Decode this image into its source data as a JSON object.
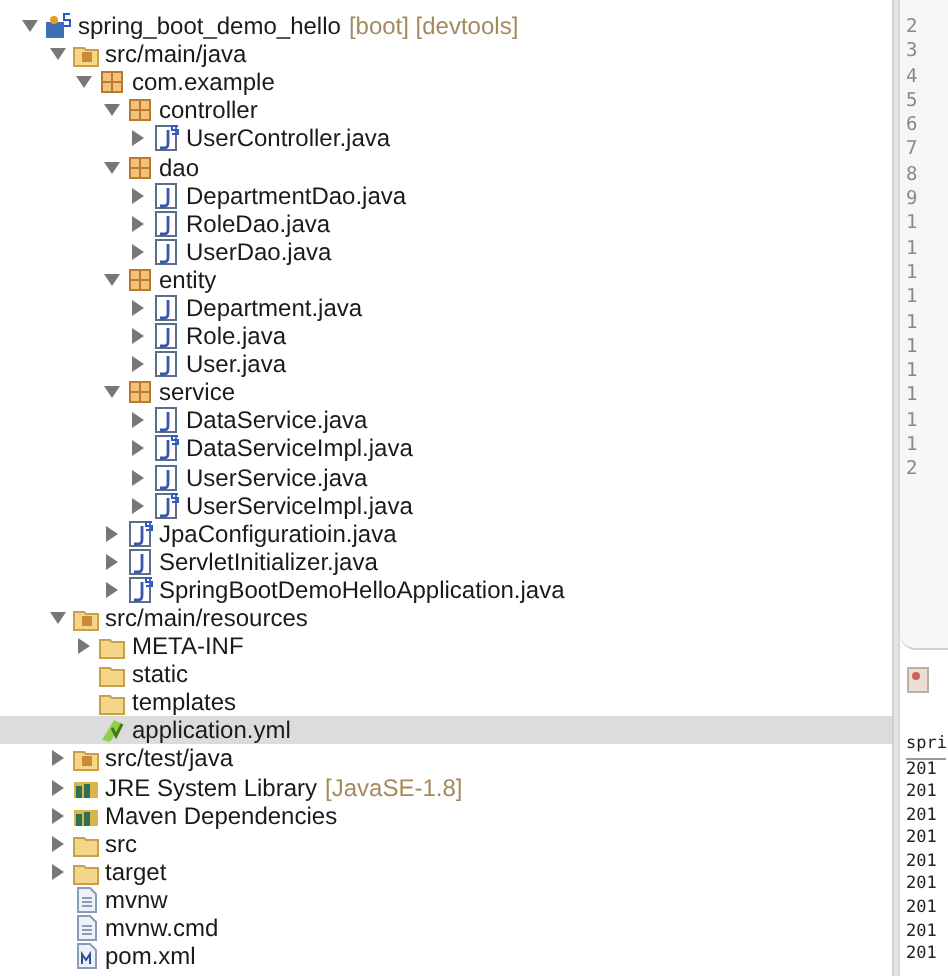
{
  "tree": [
    {
      "label": "spring_boot_demo_hello",
      "decoration": "[boot] [devtools]",
      "kind": "project",
      "expandable": true,
      "expanded": true,
      "selected": false,
      "children": [
        {
          "label": "src/main/java",
          "kind": "source-folder",
          "expandable": true,
          "expanded": true,
          "selected": false,
          "children": [
            {
              "label": "com.example",
              "kind": "package",
              "expandable": true,
              "expanded": true,
              "selected": false,
              "children": [
                {
                  "label": "controller",
                  "kind": "package",
                  "expandable": true,
                  "expanded": true,
                  "selected": false,
                  "children": [
                    {
                      "label": "UserController.java",
                      "kind": "spring-java",
                      "expandable": true,
                      "expanded": false,
                      "selected": false
                    }
                  ]
                },
                {
                  "label": "dao",
                  "kind": "package",
                  "expandable": true,
                  "expanded": true,
                  "selected": false,
                  "children": [
                    {
                      "label": "DepartmentDao.java",
                      "kind": "java",
                      "expandable": true,
                      "expanded": false,
                      "selected": false
                    },
                    {
                      "label": "RoleDao.java",
                      "kind": "java",
                      "expandable": true,
                      "expanded": false,
                      "selected": false
                    },
                    {
                      "label": "UserDao.java",
                      "kind": "java",
                      "expandable": true,
                      "expanded": false,
                      "selected": false
                    }
                  ]
                },
                {
                  "label": "entity",
                  "kind": "package",
                  "expandable": true,
                  "expanded": true,
                  "selected": false,
                  "children": [
                    {
                      "label": "Department.java",
                      "kind": "java",
                      "expandable": true,
                      "expanded": false,
                      "selected": false
                    },
                    {
                      "label": "Role.java",
                      "kind": "java",
                      "expandable": true,
                      "expanded": false,
                      "selected": false
                    },
                    {
                      "label": "User.java",
                      "kind": "java",
                      "expandable": true,
                      "expanded": false,
                      "selected": false
                    }
                  ]
                },
                {
                  "label": "service",
                  "kind": "package",
                  "expandable": true,
                  "expanded": true,
                  "selected": false,
                  "children": [
                    {
                      "label": "DataService.java",
                      "kind": "java",
                      "expandable": true,
                      "expanded": false,
                      "selected": false
                    },
                    {
                      "label": "DataServiceImpl.java",
                      "kind": "spring-java",
                      "expandable": true,
                      "expanded": false,
                      "selected": false
                    },
                    {
                      "label": "UserService.java",
                      "kind": "java",
                      "expandable": true,
                      "expanded": false,
                      "selected": false
                    },
                    {
                      "label": "UserServiceImpl.java",
                      "kind": "spring-java",
                      "expandable": true,
                      "expanded": false,
                      "selected": false
                    }
                  ]
                },
                {
                  "label": "JpaConfiguratioin.java",
                  "kind": "spring-java",
                  "expandable": true,
                  "expanded": false,
                  "selected": false
                },
                {
                  "label": "ServletInitializer.java",
                  "kind": "java",
                  "expandable": true,
                  "expanded": false,
                  "selected": false
                },
                {
                  "label": "SpringBootDemoHelloApplication.java",
                  "kind": "spring-java",
                  "expandable": true,
                  "expanded": false,
                  "selected": false
                }
              ]
            }
          ]
        },
        {
          "label": "src/main/resources",
          "kind": "source-folder",
          "expandable": true,
          "expanded": true,
          "selected": false,
          "children": [
            {
              "label": "META-INF",
              "kind": "folder",
              "expandable": true,
              "expanded": false,
              "selected": false
            },
            {
              "label": "static",
              "kind": "folder",
              "expandable": false,
              "selected": false
            },
            {
              "label": "templates",
              "kind": "folder",
              "expandable": false,
              "selected": false
            },
            {
              "label": "application.yml",
              "kind": "yml",
              "expandable": false,
              "selected": true
            }
          ]
        },
        {
          "label": "src/test/java",
          "kind": "source-folder",
          "expandable": true,
          "expanded": false,
          "selected": false
        },
        {
          "label": "JRE System Library",
          "decoration": "[JavaSE-1.8]",
          "kind": "library",
          "expandable": true,
          "expanded": false,
          "selected": false
        },
        {
          "label": "Maven Dependencies",
          "kind": "library",
          "expandable": true,
          "expanded": false,
          "selected": false
        },
        {
          "label": "src",
          "kind": "folder",
          "expandable": true,
          "expanded": false,
          "selected": false
        },
        {
          "label": "target",
          "kind": "folder",
          "expandable": true,
          "expanded": false,
          "selected": false
        },
        {
          "label": "mvnw",
          "kind": "file",
          "expandable": false,
          "selected": false
        },
        {
          "label": "mvnw.cmd",
          "kind": "file",
          "expandable": false,
          "selected": false
        },
        {
          "label": "pom.xml",
          "kind": "pom",
          "expandable": false,
          "selected": false
        }
      ]
    }
  ],
  "editor": {
    "line_numbers": [
      "2",
      "3",
      "4",
      "5",
      "6",
      "7",
      "8",
      "9",
      "1",
      "1",
      "1",
      "1",
      "1",
      "1",
      "1",
      "1",
      "1",
      "1",
      "2"
    ]
  },
  "console": {
    "header": "spri",
    "lines": [
      "201",
      "201",
      "201",
      "201",
      "201",
      "201",
      "201",
      "201",
      "201"
    ]
  }
}
